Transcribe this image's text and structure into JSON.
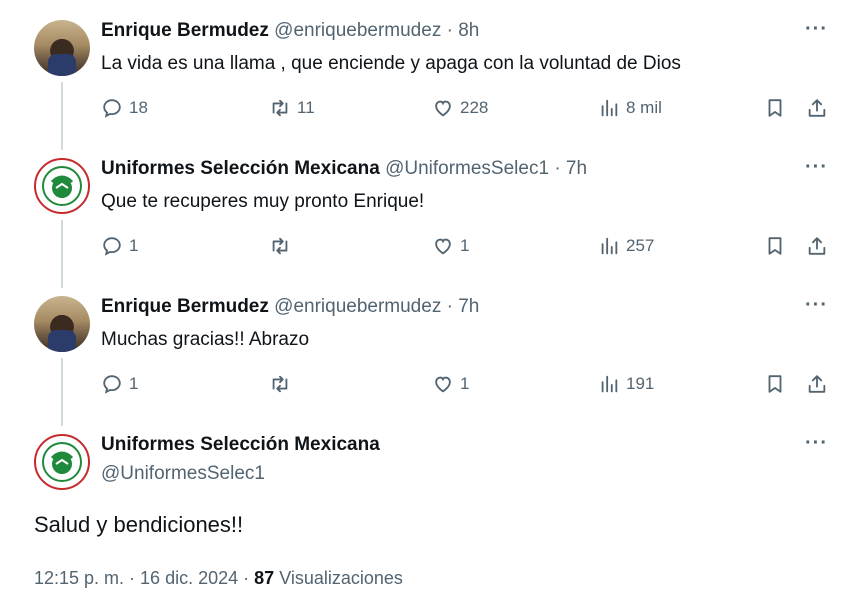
{
  "tweets": [
    {
      "name": "Enrique Bermudez",
      "handle": "@enriquebermudez",
      "sep": "·",
      "time": "8h",
      "text": "La vida es una llama , que enciende y apaga con la voluntad de Dios",
      "replies": "18",
      "retweets": "11",
      "likes": "228",
      "views": "8 mil",
      "avatar": "photo"
    },
    {
      "name": "Uniformes Selección Mexicana",
      "handle": "@UniformesSelec1",
      "sep": "·",
      "time": "7h",
      "text": "Que te recuperes muy pronto Enrique!",
      "replies": "1",
      "retweets": "",
      "likes": "1",
      "views": "257",
      "avatar": "logo"
    },
    {
      "name": "Enrique Bermudez",
      "handle": "@enriquebermudez",
      "sep": "·",
      "time": "7h",
      "text": "Muchas gracias!! Abrazo",
      "replies": "1",
      "retweets": "",
      "likes": "1",
      "views": "191",
      "avatar": "photo"
    }
  ],
  "main": {
    "name": "Uniformes Selección Mexicana",
    "handle": "@UniformesSelec1",
    "text": "Salud y bendiciones!!",
    "timestamp": "12:15 p. m. · 16 dic. 2024 ·",
    "views_count": "87",
    "views_label": "Visualizaciones"
  },
  "more_label": "···",
  "colors": {
    "secondary": "#536471",
    "line": "#cfd9de",
    "logo_green": "#1f8a3c",
    "logo_red": "#c62b2b"
  },
  "icons": [
    "reply-icon",
    "retweet-icon",
    "like-icon",
    "views-icon",
    "bookmark-icon",
    "share-icon",
    "more-icon"
  ]
}
